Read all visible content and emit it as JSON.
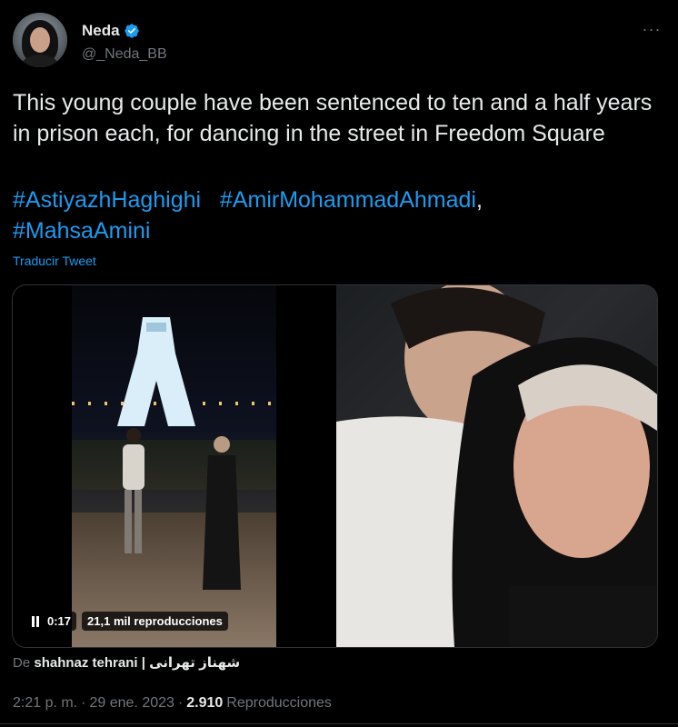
{
  "author": {
    "name": "Neda",
    "handle": "@_Neda_BB",
    "verified_icon": "verified-badge-icon",
    "avatar_icon": "avatar"
  },
  "more_label": "···",
  "tweet": {
    "text": "This young couple have been sentenced to ten and a half years in prison each, for dancing in the street in Freedom Square",
    "hashtags": [
      "#AstiyazhHaghighi",
      "#AmirMohammadAhmadi",
      "#MahsaAmini"
    ],
    "translate_label": "Traducir Tweet"
  },
  "media": {
    "video": {
      "time": "0:17",
      "views_label": "21,1 mil reproducciones"
    }
  },
  "via": {
    "prefix": "De",
    "source": "shahnaz tehrani | شهناز تهرانی"
  },
  "meta": {
    "time": "2:21 p. m.",
    "dot": "·",
    "date": "29 ene. 2023",
    "views_count": "2.910",
    "views_label": "Reproducciones"
  },
  "colors": {
    "accent": "#1d9bf0",
    "text": "#e7e9ea",
    "muted": "#71767b",
    "background": "#000000"
  }
}
